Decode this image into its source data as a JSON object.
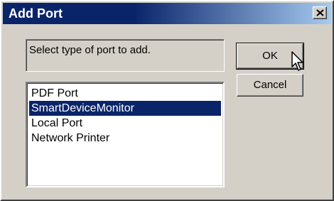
{
  "window": {
    "title": "Add Port"
  },
  "description": {
    "text": "Select type of port to add."
  },
  "port_list": {
    "items": [
      {
        "label": "PDF Port",
        "selected": false
      },
      {
        "label": "SmartDeviceMonitor",
        "selected": true
      },
      {
        "label": "Local Port",
        "selected": false
      },
      {
        "label": "Network Printer",
        "selected": false
      }
    ]
  },
  "buttons": {
    "ok_label": "OK",
    "cancel_label": "Cancel"
  },
  "icons": {
    "close": "close-icon",
    "cursor": "mouse-pointer-icon"
  },
  "colors": {
    "title_bar": "#0a246a",
    "selection": "#0a246a",
    "dialog_bg": "#d4d0c8"
  }
}
